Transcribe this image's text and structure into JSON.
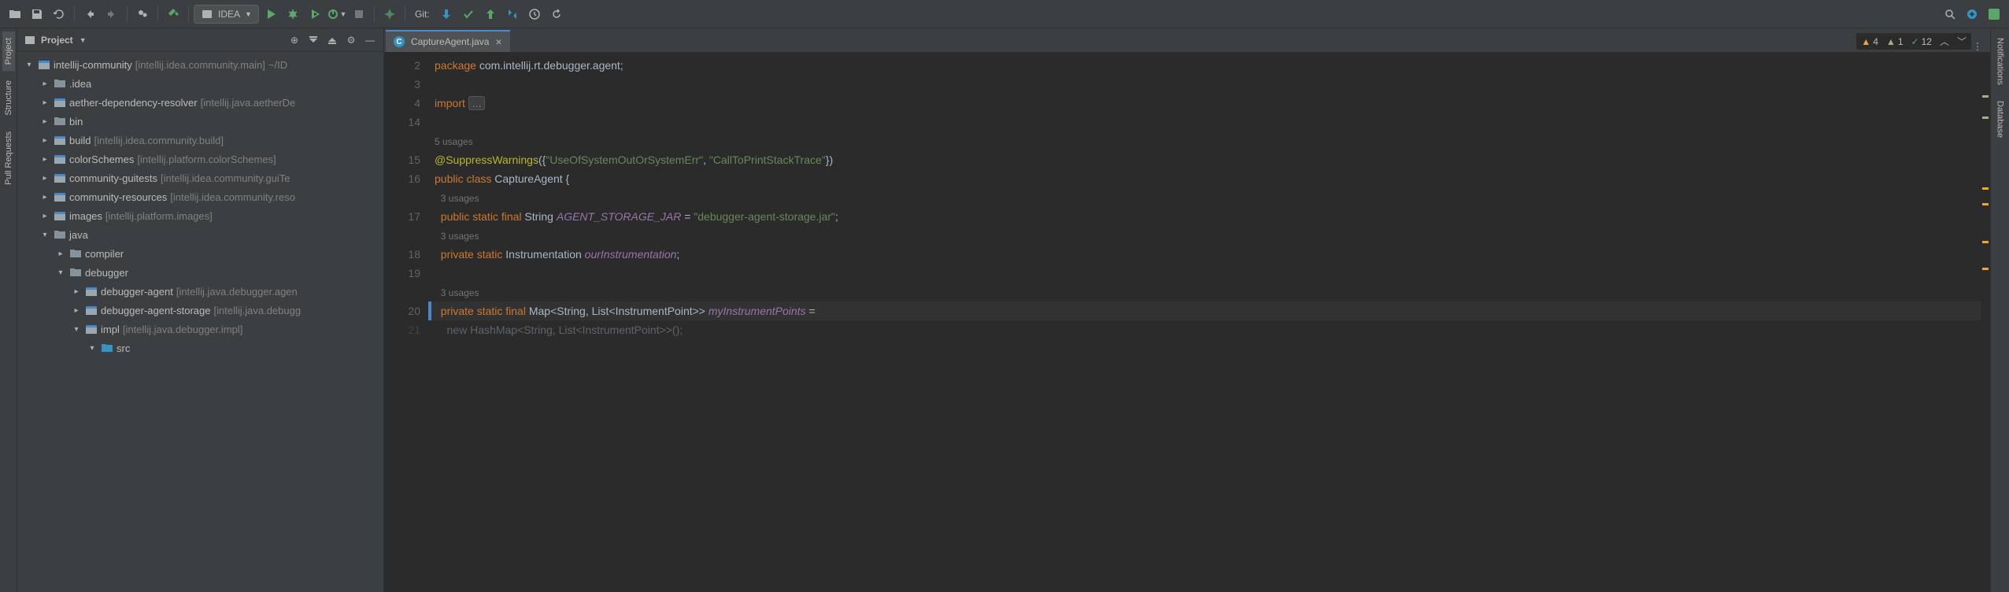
{
  "toolbar": {
    "run_config": "IDEA",
    "git_label": "Git:"
  },
  "left_tabs": [
    "Project",
    "Structure",
    "Pull Requests"
  ],
  "right_tabs": [
    "Notifications",
    "Database"
  ],
  "project_panel": {
    "title": "Project"
  },
  "tree": [
    {
      "indent": 0,
      "chev": "down",
      "icon": "module",
      "label": "intellij-community",
      "module": "[intellij.idea.community.main]",
      "extra": "~/ID"
    },
    {
      "indent": 1,
      "chev": "right",
      "icon": "folder",
      "label": ".idea",
      "module": ""
    },
    {
      "indent": 1,
      "chev": "right",
      "icon": "module",
      "label": "aether-dependency-resolver",
      "module": "[intellij.java.aetherDe"
    },
    {
      "indent": 1,
      "chev": "right",
      "icon": "folder",
      "label": "bin",
      "module": ""
    },
    {
      "indent": 1,
      "chev": "right",
      "icon": "module",
      "label": "build",
      "module": "[intellij.idea.community.build]"
    },
    {
      "indent": 1,
      "chev": "right",
      "icon": "module",
      "label": "colorSchemes",
      "module": "[intellij.platform.colorSchemes]"
    },
    {
      "indent": 1,
      "chev": "right",
      "icon": "module",
      "label": "community-guitests",
      "module": "[intellij.idea.community.guiTe"
    },
    {
      "indent": 1,
      "chev": "right",
      "icon": "module",
      "label": "community-resources",
      "module": "[intellij.idea.community.reso"
    },
    {
      "indent": 1,
      "chev": "right",
      "icon": "module",
      "label": "images",
      "module": "[intellij.platform.images]"
    },
    {
      "indent": 1,
      "chev": "down",
      "icon": "folder",
      "label": "java",
      "module": ""
    },
    {
      "indent": 2,
      "chev": "right",
      "icon": "folder",
      "label": "compiler",
      "module": ""
    },
    {
      "indent": 2,
      "chev": "down",
      "icon": "folder",
      "label": "debugger",
      "module": ""
    },
    {
      "indent": 3,
      "chev": "right",
      "icon": "module",
      "label": "debugger-agent",
      "module": "[intellij.java.debugger.agen"
    },
    {
      "indent": 3,
      "chev": "right",
      "icon": "module",
      "label": "debugger-agent-storage",
      "module": "[intellij.java.debugg"
    },
    {
      "indent": 3,
      "chev": "down",
      "icon": "module",
      "label": "impl",
      "module": "[intellij.java.debugger.impl]"
    },
    {
      "indent": 4,
      "chev": "down",
      "icon": "srcfolder",
      "label": "src",
      "module": ""
    }
  ],
  "tabs": [
    {
      "label": "CaptureAgent.java"
    }
  ],
  "inspection": {
    "warnings": "4",
    "weak": "1",
    "typos": "12"
  },
  "code": {
    "line2": {
      "n": "2",
      "pkg": "package",
      "path": " com.intellij.rt.debugger.agent;"
    },
    "line3": {
      "n": "3"
    },
    "line4": {
      "n": "4",
      "imp": "import",
      "fold": "..."
    },
    "line14": {
      "n": "14"
    },
    "usages5": "5 usages",
    "line15": {
      "n": "15",
      "ann": "@SuppressWarnings",
      "args_open": "({",
      "str1": "\"UseOfSystemOutOrSystemErr\"",
      "comma": ", ",
      "str2": "\"CallToPrintStackTrace\"",
      "args_close": "})"
    },
    "line16": {
      "n": "16",
      "kw": "public class",
      "name": " CaptureAgent {"
    },
    "usages3a": "3 usages",
    "line17": {
      "n": "17",
      "kw": "public static final",
      "type": " String ",
      "fld": "AGENT_STORAGE_JAR",
      "eq": " = ",
      "str": "\"debugger-agent-storage.jar\"",
      "semi": ";"
    },
    "usages3b": "3 usages",
    "line18": {
      "n": "18",
      "kw": "private static",
      "type": " Instrumentation ",
      "fld": "ourInstrumentation",
      "semi": ";"
    },
    "line19": {
      "n": "19"
    },
    "usages3c": "3 usages",
    "line20": {
      "n": "20",
      "kw": "private static final",
      "type": " Map<String, List<InstrumentPoint>> ",
      "fld": "myInstrumentPoints",
      "eq": " ="
    },
    "line21": {
      "n": "21",
      "txt": "    new HashMap<String, List<InstrumentPoint>>();"
    }
  }
}
